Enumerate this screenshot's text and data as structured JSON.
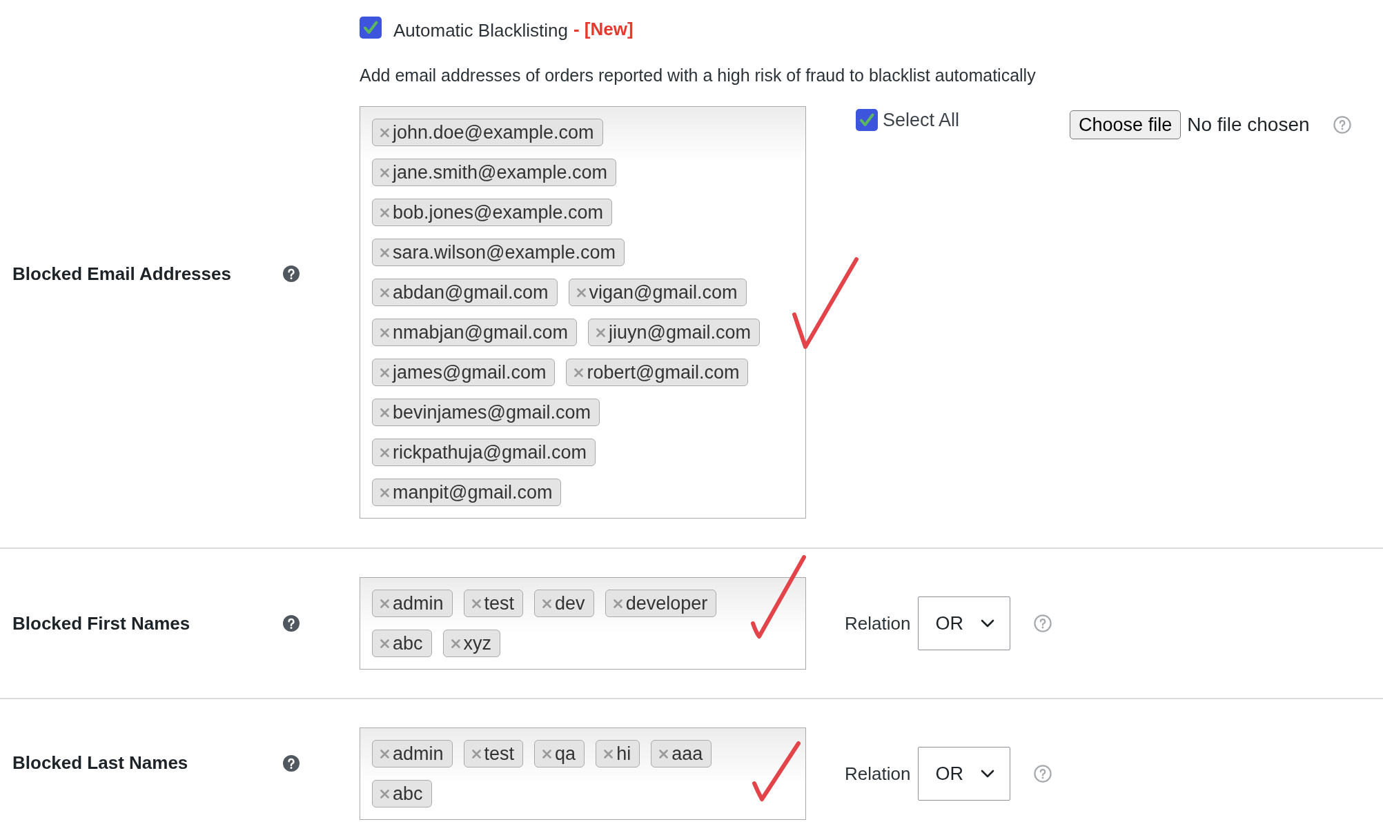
{
  "sections": [
    {
      "kind": "emails",
      "label": "Blocked Email Addresses",
      "auto_blacklist": {
        "label": "Automatic Blacklisting",
        "badge": "- [New]",
        "checked": true
      },
      "description": "Add email addresses of orders reported with a high risk of fraud to blacklist automatically",
      "tags": [
        "john.doe@example.com",
        "jane.smith@example.com",
        "bob.jones@example.com",
        "sara.wilson@example.com",
        "abdan@gmail.com",
        "vigan@gmail.com",
        "nmabjan@gmail.com",
        "jiuyn@gmail.com",
        "james@gmail.com",
        "robert@gmail.com",
        "bevinjames@gmail.com",
        "rickpathuja@gmail.com",
        "manpit@gmail.com"
      ],
      "annotated": true,
      "select_all": {
        "label": "Select All",
        "checked": true
      },
      "file_input": {
        "button": "Choose file",
        "status": "No file chosen"
      }
    },
    {
      "kind": "names",
      "label": "Blocked First Names",
      "tags": [
        "admin",
        "test",
        "dev",
        "developer",
        "abc",
        "xyz"
      ],
      "annotated": true,
      "relation": {
        "label": "Relation",
        "value": "OR"
      }
    },
    {
      "kind": "names",
      "label": "Blocked Last Names",
      "tags": [
        "admin",
        "test",
        "qa",
        "hi",
        "aaa",
        "abc"
      ],
      "annotated": true,
      "relation": {
        "label": "Relation",
        "value": "OR"
      }
    }
  ]
}
